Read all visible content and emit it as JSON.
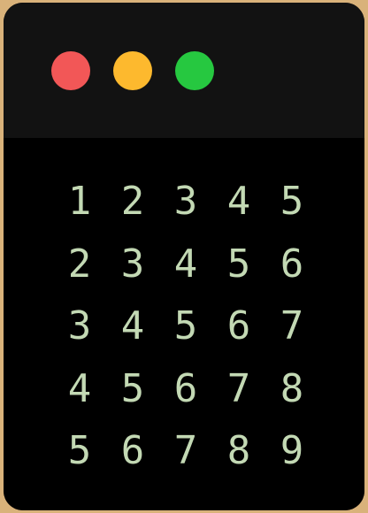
{
  "window": {
    "traffic_lights": [
      {
        "name": "close",
        "color": "#f25757"
      },
      {
        "name": "minimize",
        "color": "#fdb92e"
      },
      {
        "name": "zoom",
        "color": "#26c840"
      }
    ]
  },
  "terminal": {
    "text_color": "#c3d9b4",
    "rows": [
      [
        "1",
        "2",
        "3",
        "4",
        "5"
      ],
      [
        "2",
        "3",
        "4",
        "5",
        "6"
      ],
      [
        "3",
        "4",
        "5",
        "6",
        "7"
      ],
      [
        "4",
        "5",
        "6",
        "7",
        "8"
      ],
      [
        "5",
        "6",
        "7",
        "8",
        "9"
      ]
    ]
  }
}
